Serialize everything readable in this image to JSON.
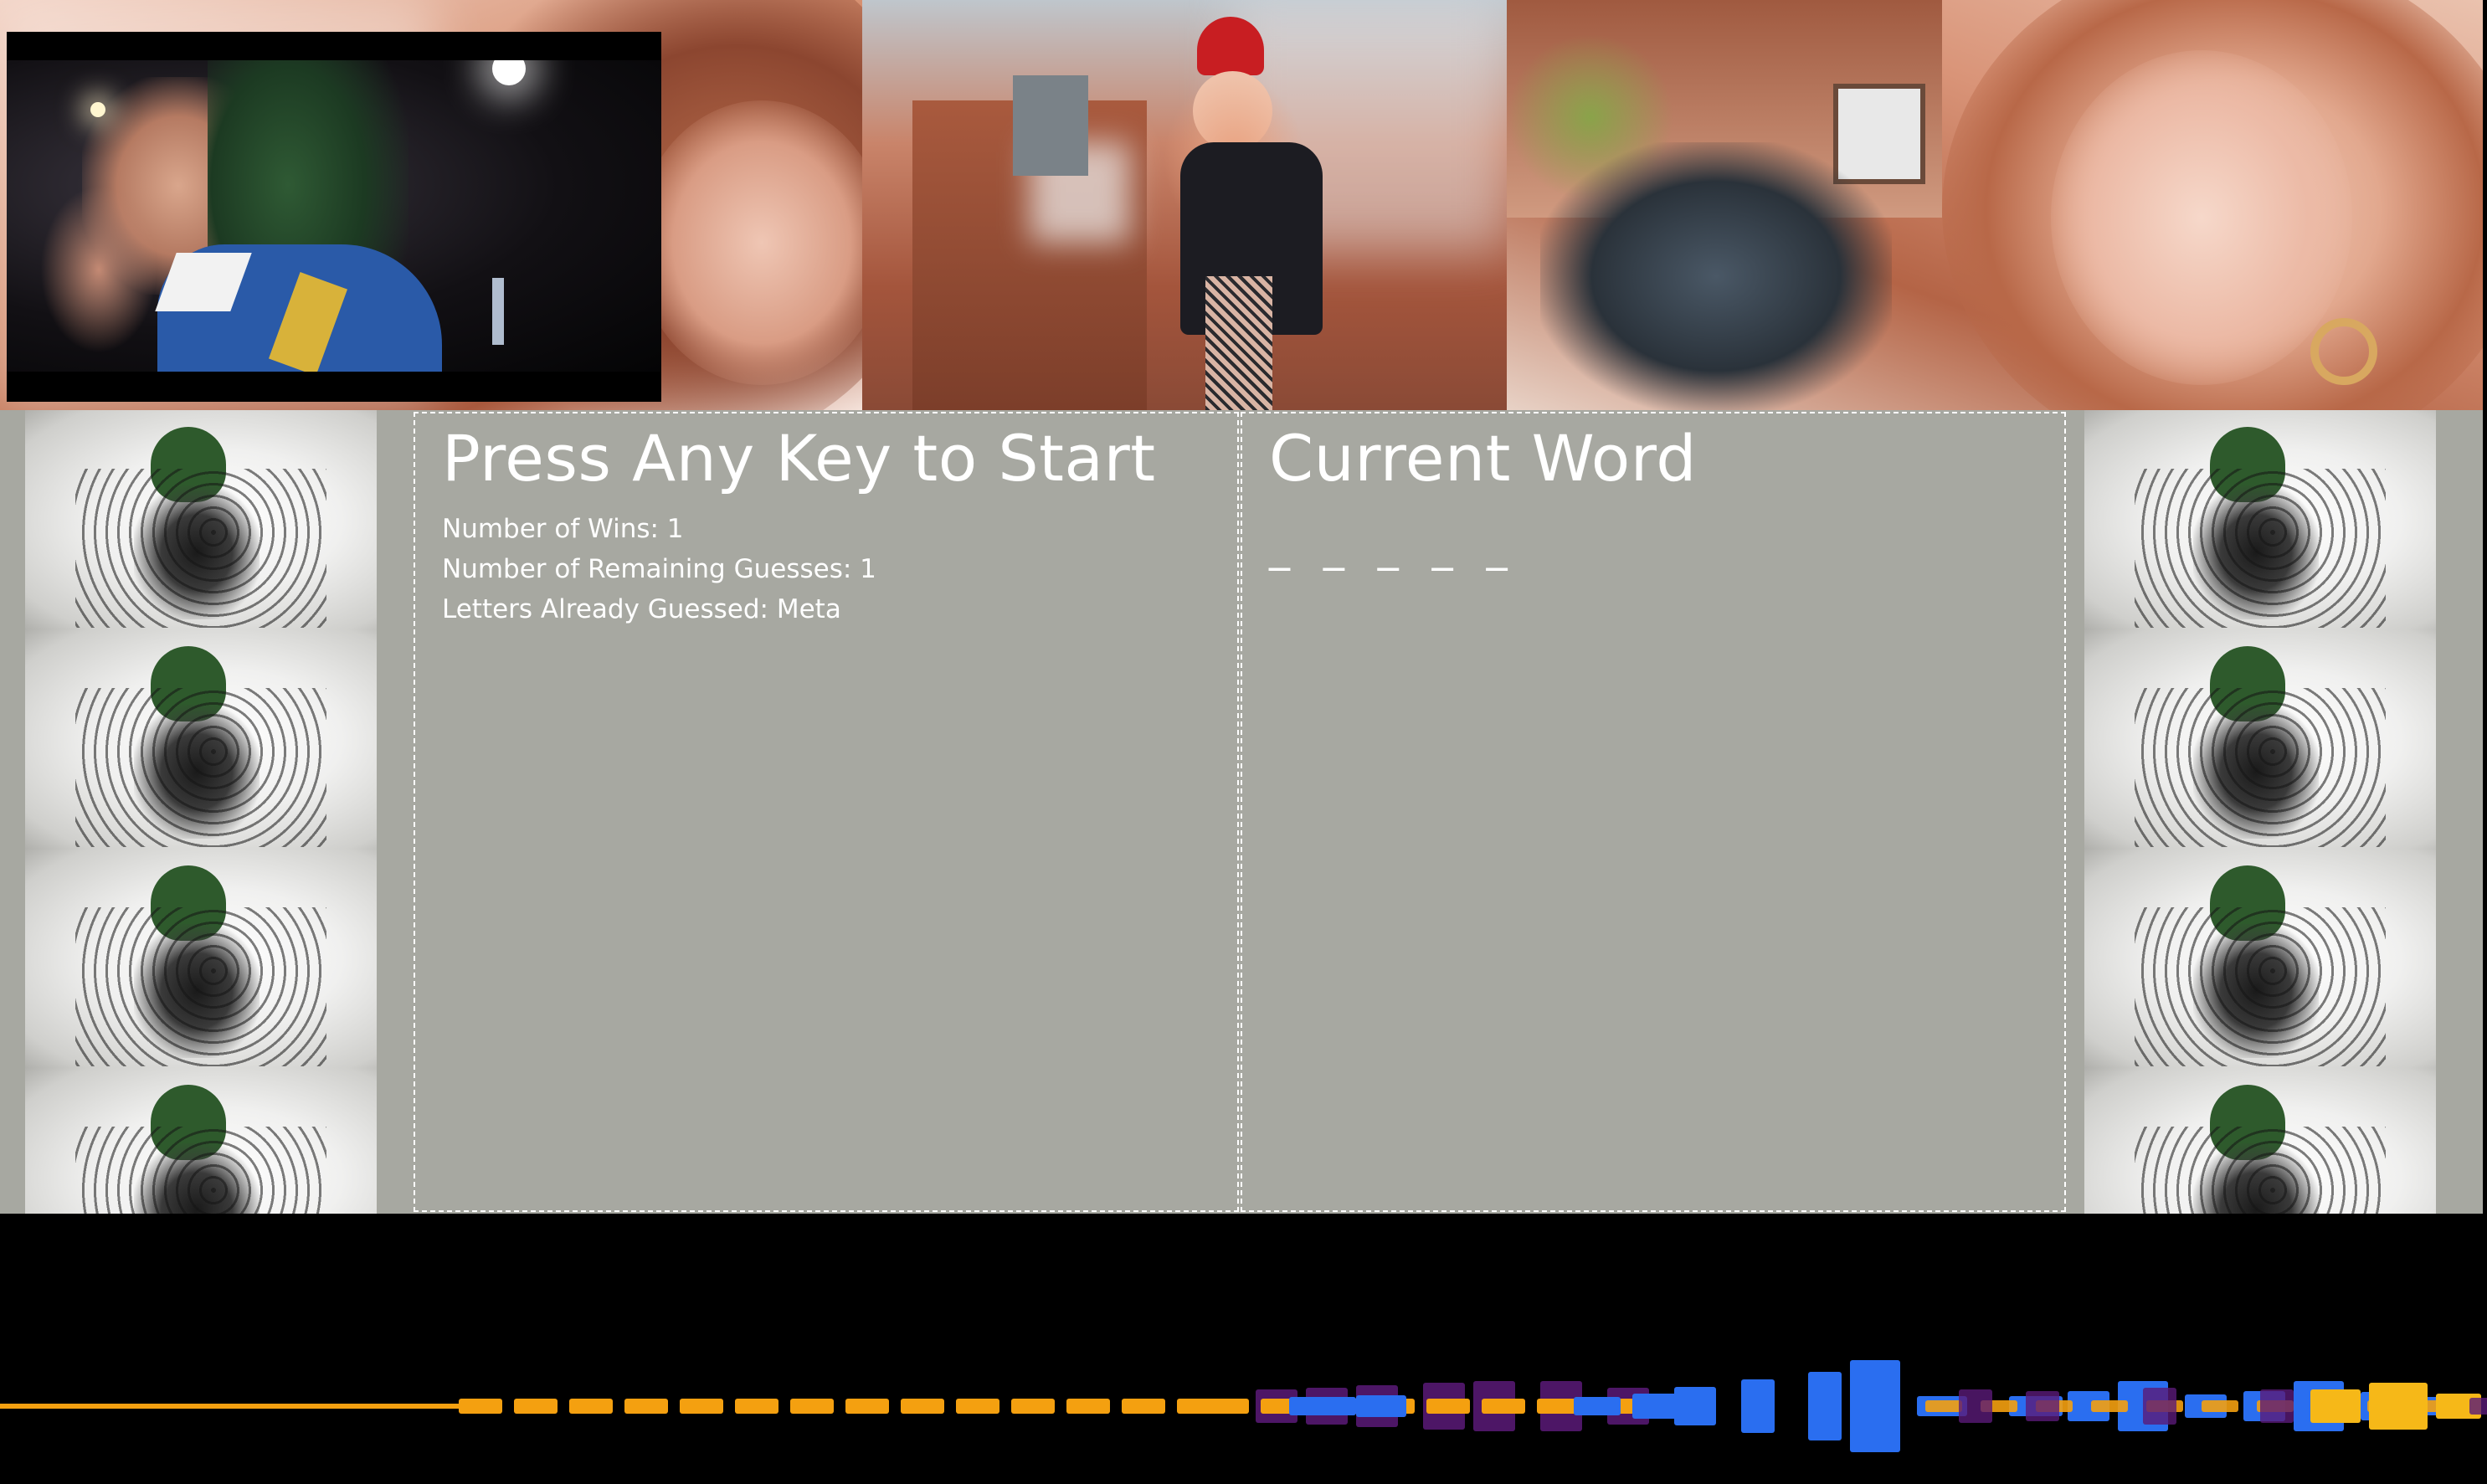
{
  "game": {
    "title": "Press Any Key to Start",
    "wins_text": "Number of Wins: 1",
    "remaining_text": "Number of Remaining Guesses: 1",
    "guessed_text": "Letters Already Guessed: Meta"
  },
  "word": {
    "title": "Current Word",
    "blanks": "_ _ _ _ _"
  },
  "colors": {
    "panel_bg": "#a7a8a1",
    "box_border": "#ffffff",
    "text": "#ffffff",
    "visualizer_orange": "#f4a010",
    "visualizer_blue": "#2a6ef0",
    "visualizer_purple": "#5a1a78",
    "visualizer_gold": "#f6b818"
  }
}
